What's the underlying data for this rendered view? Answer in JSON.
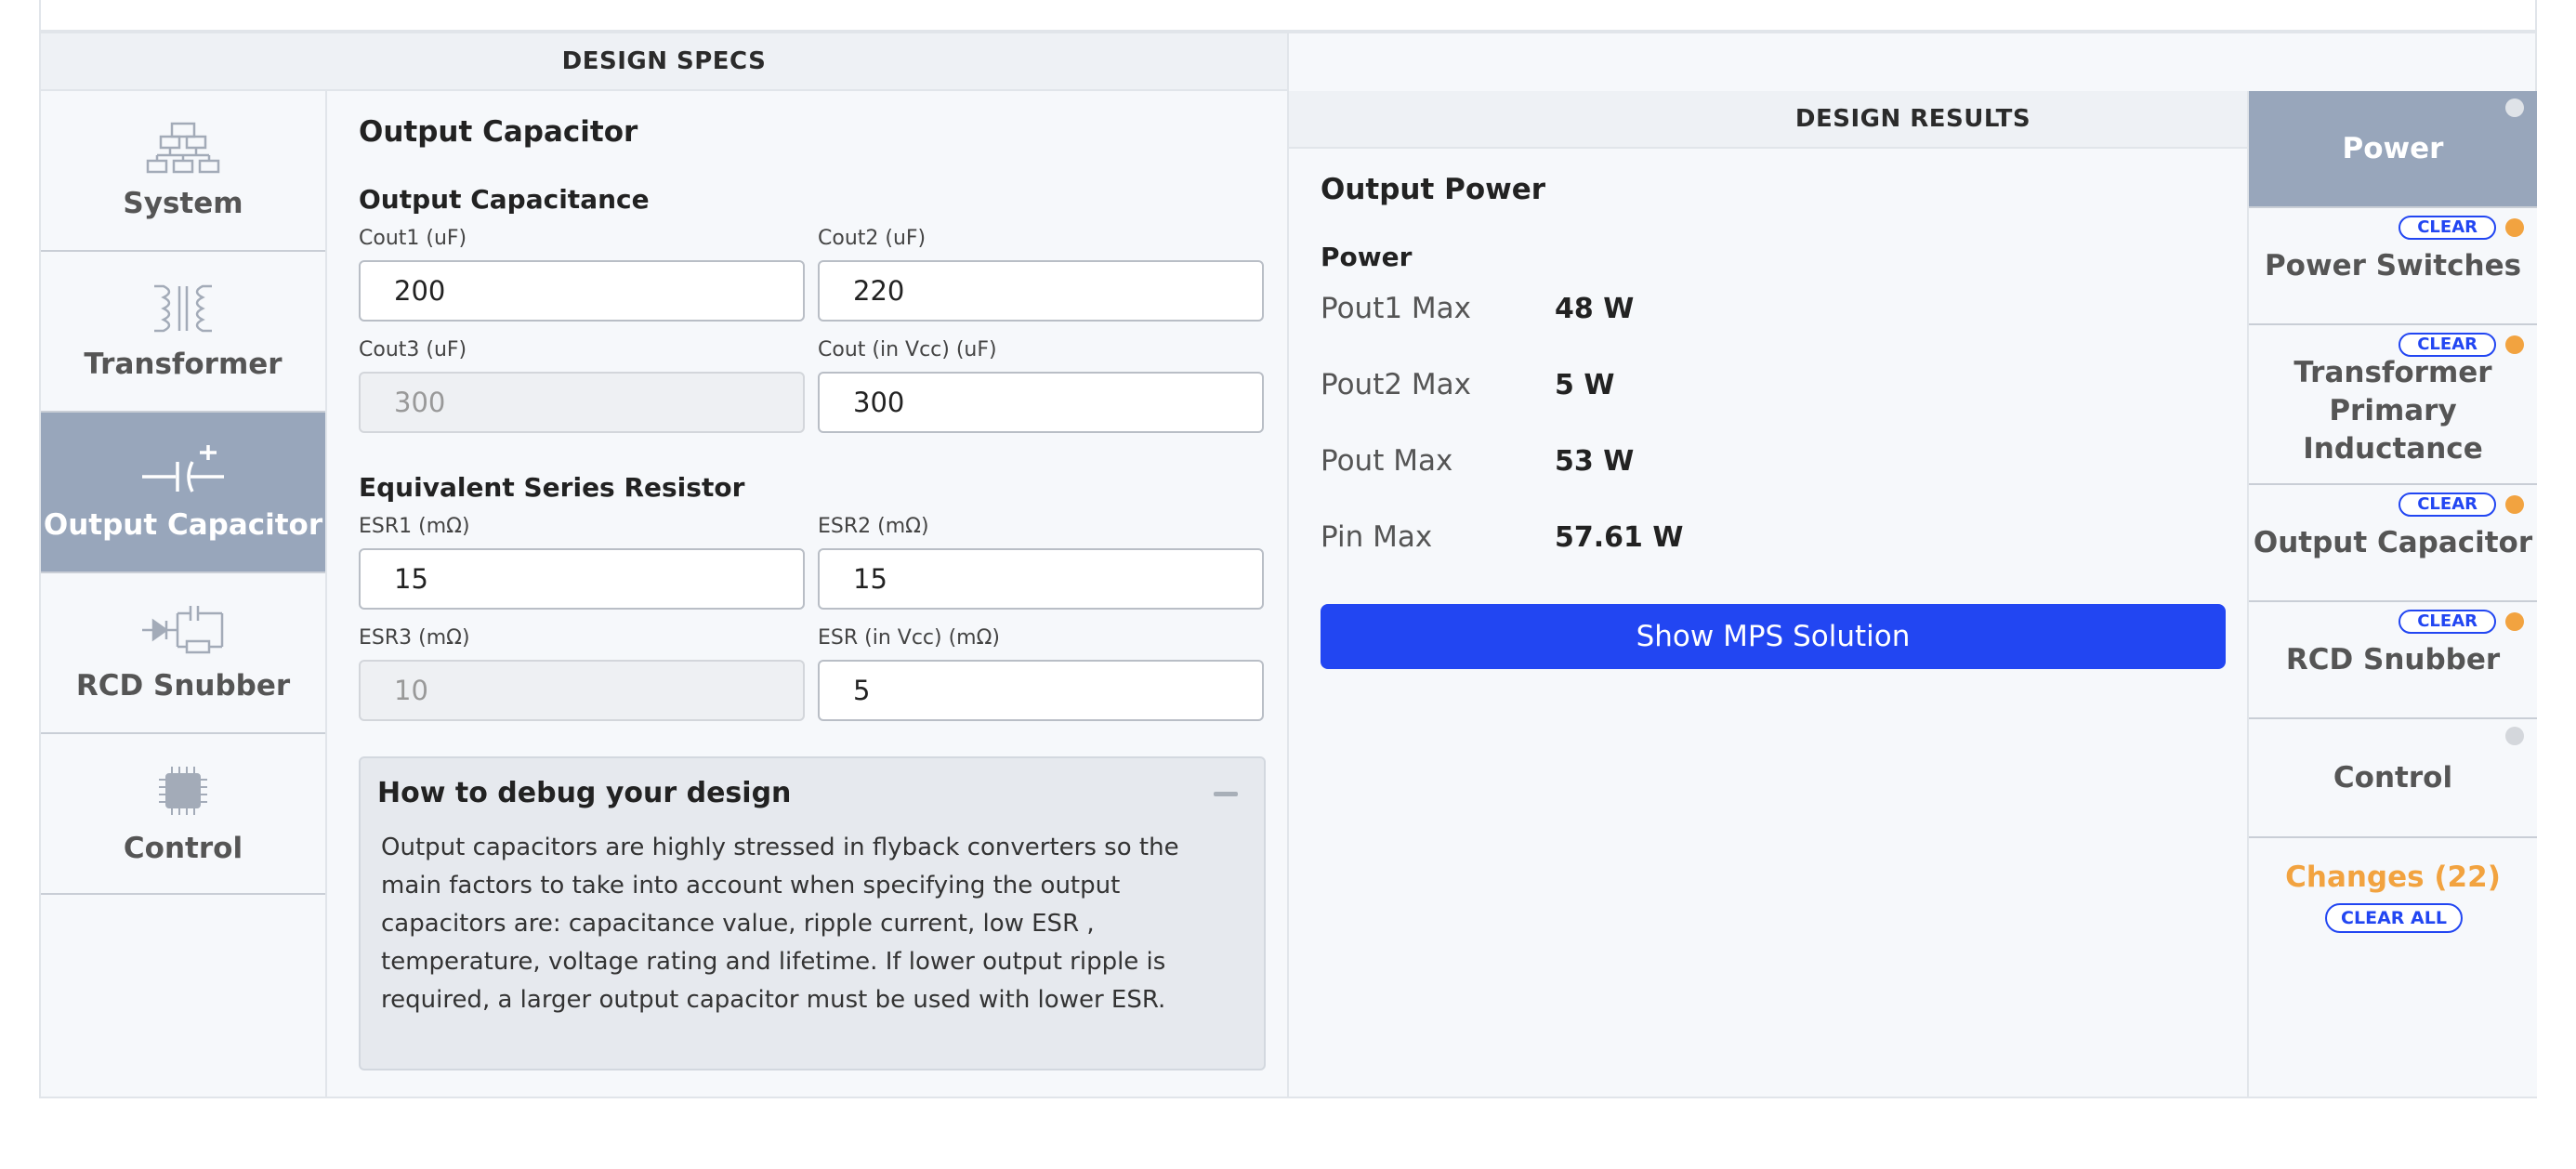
{
  "headers": {
    "specs": "DESIGN SPECS",
    "results": "DESIGN RESULTS"
  },
  "left_nav": [
    {
      "label": "System",
      "icon": "system-icon"
    },
    {
      "label": "Transformer",
      "icon": "transformer-icon"
    },
    {
      "label": "Output Capacitor",
      "icon": "capacitor-icon",
      "active": true
    },
    {
      "label": "RCD Snubber",
      "icon": "snubber-icon"
    },
    {
      "label": "Control",
      "icon": "chip-icon"
    }
  ],
  "form": {
    "title": "Output Capacitor",
    "capacitance": {
      "title": "Output Capacitance",
      "cout1": {
        "label": "Cout1 (uF)",
        "value": "200"
      },
      "cout2": {
        "label": "Cout2 (uF)",
        "value": "220"
      },
      "cout3": {
        "label": "Cout3 (uF)",
        "value": "300"
      },
      "cout_vcc": {
        "label": "Cout (in Vcc) (uF)",
        "value": "300"
      }
    },
    "esr": {
      "title": "Equivalent Series Resistor",
      "esr1": {
        "label": "ESR1 (mΩ)",
        "value": "15"
      },
      "esr2": {
        "label": "ESR2 (mΩ)",
        "value": "15"
      },
      "esr3": {
        "label": "ESR3 (mΩ)",
        "value": "10"
      },
      "esr_vcc": {
        "label": "ESR (in Vcc) (mΩ)",
        "value": "5"
      }
    }
  },
  "debug": {
    "title": "How to debug your design",
    "text": "Output capacitors are highly stressed in flyback converters so the main factors to take into account when specifying the output capacitors are: capacitance value, ripple current, low ESR , temperature, voltage rating and lifetime. If lower output ripple is required, a larger output capacitor must be used with lower ESR."
  },
  "results": {
    "title": "Output Power",
    "subtitle": "Power",
    "rows": [
      {
        "label": "Pout1 Max",
        "value": "48 W"
      },
      {
        "label": "Pout2 Max",
        "value": "5 W"
      },
      {
        "label": "Pout Max",
        "value": "53 W"
      },
      {
        "label": "Pin Max",
        "value": "57.61 W"
      }
    ],
    "button": "Show MPS Solution"
  },
  "right_nav": {
    "items": [
      {
        "label": "Power"
      },
      {
        "label": "Power Switches",
        "clear": "CLEAR"
      },
      {
        "label": "Transformer Primary Inductance",
        "clear": "CLEAR"
      },
      {
        "label": "Output Capacitor",
        "clear": "CLEAR"
      },
      {
        "label": "RCD Snubber",
        "clear": "CLEAR"
      },
      {
        "label": "Control"
      }
    ],
    "changes": "Changes (22)",
    "clear_all": "CLEAR ALL"
  },
  "colors": {
    "accent": "#2246f2",
    "active_nav": "#98a6bb",
    "changed_dot": "#f2a340",
    "changes_text": "#f2a340"
  }
}
